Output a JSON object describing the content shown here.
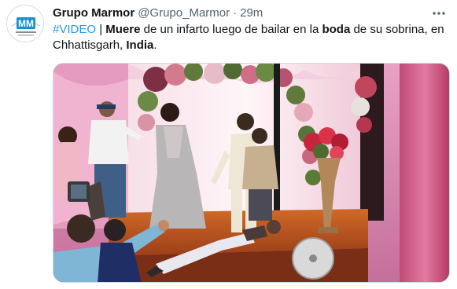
{
  "tweet": {
    "display_name": "Grupo Marmor",
    "handle": "@Grupo_Marmor",
    "separator": "·",
    "time": "29m",
    "text": {
      "hashtag": "#VIDEO",
      "t1": " | ",
      "b1": "Muere",
      "t2": " de un infarto luego de bailar en la ",
      "b2": "boda",
      "t3": " de su sobrina, en Chhattisgarh, ",
      "b3": "India",
      "t4": "."
    }
  },
  "avatar": {
    "logo_text": "MM",
    "logo_color": "#1a8fc9"
  },
  "icons": {
    "more": "more-dots-icon"
  },
  "colors": {
    "link": "#1d9bf0",
    "secondary_text": "#536471",
    "media_border": "#cfd9de"
  }
}
